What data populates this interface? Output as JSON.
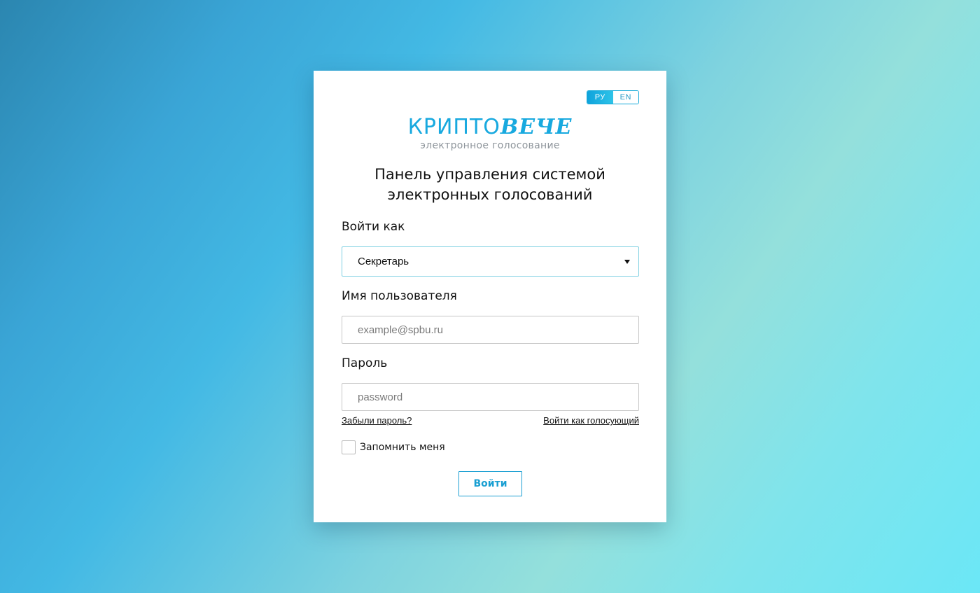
{
  "language_switch": {
    "ru_label": "РУ",
    "en_label": "EN",
    "active": "ru"
  },
  "logo": {
    "part1": "КРИПТО",
    "part2": "ВЕЧЕ",
    "subtitle": "электронное голосование"
  },
  "title_line1": "Панель управления системой",
  "title_line2": "электронных голосований",
  "form": {
    "role_label": "Войти как",
    "role_selected": "Секретарь",
    "username_label": "Имя пользователя",
    "username_placeholder": "example@spbu.ru",
    "password_label": "Пароль",
    "password_placeholder": "password",
    "forgot_link": "Забыли пароль?",
    "voter_link": "Войти как голосующий",
    "remember_label": "Запомнить меня",
    "remember_checked": false,
    "submit_label": "Войти"
  },
  "colors": {
    "accent": "#1a9fd2",
    "logo_blue": "#18a9df"
  }
}
